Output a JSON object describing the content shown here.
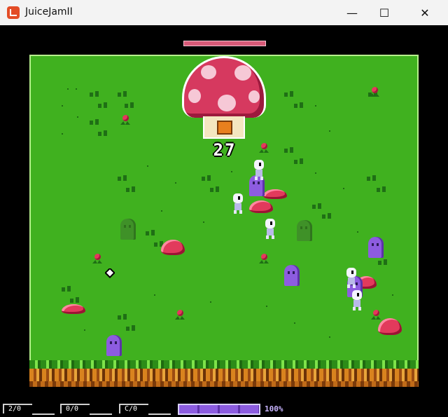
{
  "window": {
    "title": "JuiceJamII",
    "minimize_glyph": "—",
    "maximize_glyph": "☐",
    "close_glyph": "✕",
    "icon": "monogame-logo-icon"
  },
  "boss": {
    "number": "27",
    "health_fraction": 1.0,
    "color": "#d6395f"
  },
  "hud": {
    "slots": [
      "2/0",
      "0/0",
      "C/0"
    ],
    "energy_fraction": 1.0,
    "energy_label": "100%"
  },
  "entities": {
    "player_count": 5,
    "ghost_count": 4,
    "faded_ghost_count": 2,
    "slime_count": 6,
    "flower_count": 9
  },
  "colors": {
    "grass": "#40b11f",
    "field_border": "#b7f08d",
    "slime": "#e23a5c",
    "ghost": "#8d5ce0",
    "energy": "#8c5ce0"
  }
}
